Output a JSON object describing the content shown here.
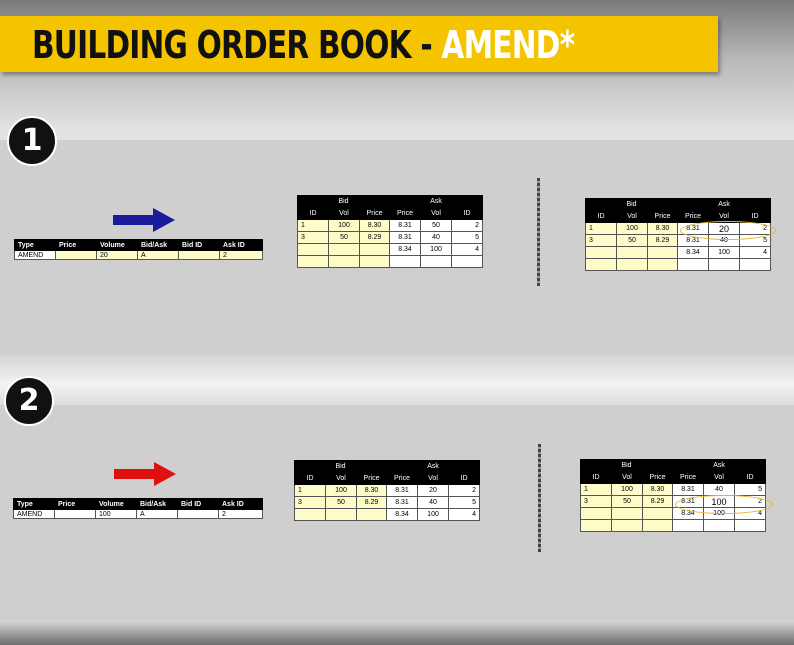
{
  "title": {
    "main": "BUILDING ORDER BOOK - ",
    "accent": "AMEND*"
  },
  "colors": {
    "title_bar": "#f5c400",
    "arrow_step1": "#1a1a9c",
    "arrow_step2": "#e01010",
    "highlight_ring": "#e7b82c"
  },
  "steps": [
    {
      "number": "1",
      "order": {
        "headers": [
          "Type",
          "Price",
          "Volume",
          "Bid/Ask",
          "Bid ID",
          "Ask ID"
        ],
        "row": [
          "AMEND",
          "",
          "20",
          "A",
          "",
          "2"
        ]
      },
      "before": {
        "group_headers": [
          "Bid",
          "Ask"
        ],
        "headers": [
          "ID",
          "Vol",
          "Price",
          "Price",
          "Vol",
          "ID"
        ],
        "rows": [
          [
            "1",
            "100",
            "8.30",
            "8.31",
            "50",
            "2"
          ],
          [
            "3",
            "50",
            "8.29",
            "8.31",
            "40",
            "5"
          ],
          [
            "",
            "",
            "",
            "8.34",
            "100",
            "4"
          ],
          [
            "",
            "",
            "",
            "",
            "",
            ""
          ]
        ]
      },
      "after": {
        "group_headers": [
          "Bid",
          "Ask"
        ],
        "headers": [
          "ID",
          "Vol",
          "Price",
          "Price",
          "Vol",
          "ID"
        ],
        "rows": [
          [
            "1",
            "100",
            "8.30",
            "8.31",
            "20",
            "2"
          ],
          [
            "3",
            "50",
            "8.29",
            "8.31",
            "40",
            "5"
          ],
          [
            "",
            "",
            "",
            "8.34",
            "100",
            "4"
          ],
          [
            "",
            "",
            "",
            "",
            "",
            ""
          ]
        ]
      }
    },
    {
      "number": "2",
      "order": {
        "headers": [
          "Type",
          "Price",
          "Volume",
          "Bid/Ask",
          "Bid ID",
          "Ask ID"
        ],
        "row": [
          "AMEND",
          "",
          "100",
          "A",
          "",
          "2"
        ]
      },
      "before": {
        "group_headers": [
          "Bid",
          "Ask"
        ],
        "headers": [
          "ID",
          "Vol",
          "Price",
          "Price",
          "Vol",
          "ID"
        ],
        "rows": [
          [
            "1",
            "100",
            "8.30",
            "8.31",
            "20",
            "2"
          ],
          [
            "3",
            "50",
            "8.29",
            "8.31",
            "40",
            "5"
          ],
          [
            "",
            "",
            "",
            "8.34",
            "100",
            "4"
          ]
        ]
      },
      "after": {
        "group_headers": [
          "Bid",
          "Ask"
        ],
        "headers": [
          "ID",
          "Vol",
          "Price",
          "Price",
          "Vol",
          "ID"
        ],
        "rows": [
          [
            "1",
            "100",
            "8.30",
            "8.31",
            "40",
            "5"
          ],
          [
            "3",
            "50",
            "8.29",
            "8.31",
            "100",
            "2"
          ],
          [
            "",
            "",
            "",
            "8.34",
            "100",
            "4"
          ],
          [
            "",
            "",
            "",
            "",
            "",
            ""
          ]
        ]
      }
    }
  ]
}
